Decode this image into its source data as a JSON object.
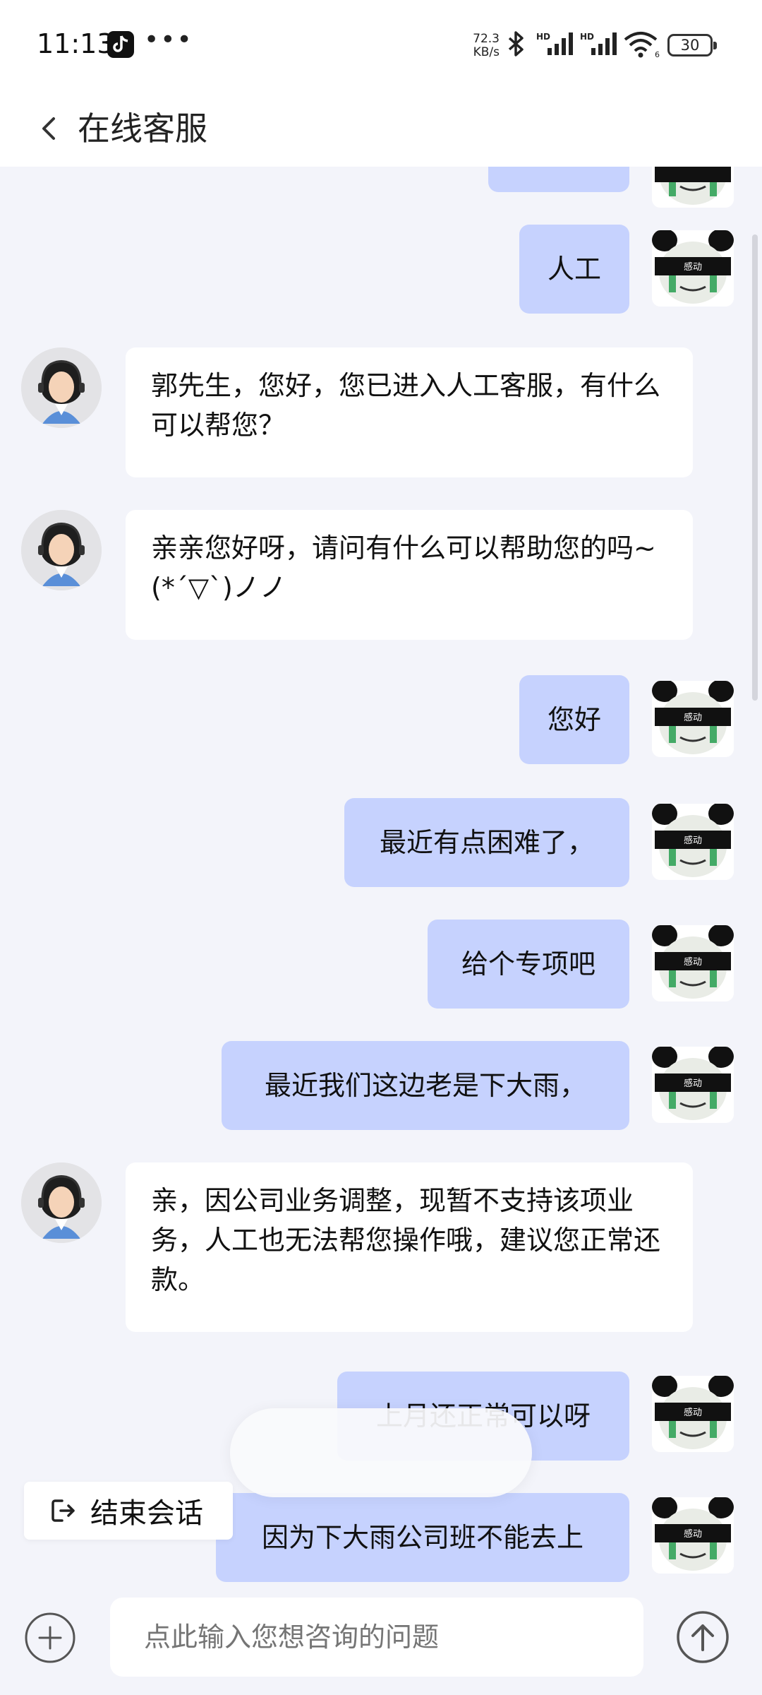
{
  "status_bar": {
    "time": "11:13",
    "speed_value": "72.3",
    "speed_unit": "KB/s",
    "battery": "30",
    "icons": [
      "tiktok-icon",
      "more-dots-icon",
      "bluetooth-icon",
      "signal-hd-icon",
      "signal-hd-icon",
      "wifi-icon",
      "battery-icon"
    ]
  },
  "header": {
    "title": "在线客服",
    "back_icon": "chevron-left-icon"
  },
  "messages": [
    {
      "from": "me",
      "text": ""
    },
    {
      "from": "me",
      "text": "人工"
    },
    {
      "from": "agent",
      "text": "郭先生，您好，您已进入人工客服，有什么可以帮您？"
    },
    {
      "from": "agent",
      "text": "亲亲您好呀，请问有什么可以帮助您的吗~(*ˊ▽ˋ)ノノ"
    },
    {
      "from": "me",
      "text": "您好"
    },
    {
      "from": "me",
      "text": "最近有点困难了，"
    },
    {
      "from": "me",
      "text": "给个专项吧"
    },
    {
      "from": "me",
      "text": "最近我们这边老是下大雨，"
    },
    {
      "from": "agent",
      "text": "亲，因公司业务调整，现暂不支持该项业务，人工也无法帮您操作哦，建议您正常还款。"
    },
    {
      "from": "me",
      "text": "上月还正常可以呀"
    },
    {
      "from": "me",
      "text": "因为下大雨公司班不能去上"
    }
  ],
  "avatar_me_caption": "感动",
  "end_session": {
    "label": "结束会话",
    "icon": "exit-icon"
  },
  "input": {
    "placeholder": "点此输入您想咨询的问题"
  },
  "bottom_icons": [
    "plus-circle-icon",
    "send-arrow-up-icon"
  ],
  "colors": {
    "my_bubble": "#c6d2fe",
    "agent_bubble": "#ffffff",
    "background": "#f3f4fa"
  }
}
